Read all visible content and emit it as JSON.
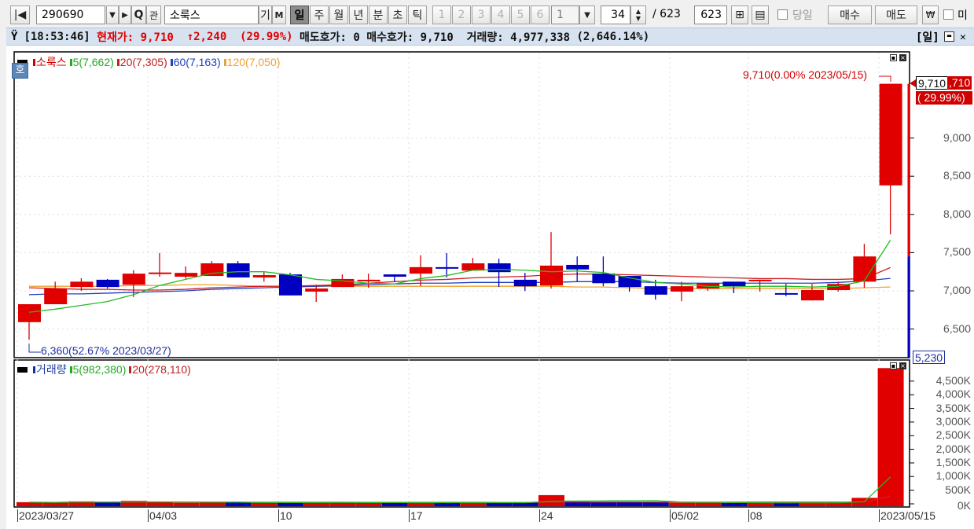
{
  "toolbar": {
    "code": "290690",
    "name": "소룩스",
    "search_icon": "Q",
    "gwan": "관",
    "gi": "기",
    "m": "M",
    "periods": [
      "일",
      "주",
      "월",
      "년",
      "분",
      "초",
      "틱"
    ],
    "selected_period": "일",
    "numbers": [
      "1",
      "2",
      "3",
      "4",
      "5",
      "6"
    ],
    "interval_select": "1",
    "view_count": "34",
    "total_sep": "/ 623",
    "total_input": "623",
    "same_day_label": "당일",
    "buy": "매수",
    "sell": "매도",
    "won": "₩",
    "mi_label": "미"
  },
  "info": {
    "time": "[18:53:46]",
    "current_label": "현재가: 9,710",
    "change": "↑2,240",
    "change_pct": "(29.99%)",
    "ask": "매도호가: 0",
    "bid": "매수호가: 9,710",
    "volume": "거래량: 4,977,338",
    "volume_pct": "(2,646.14%)",
    "period_badge": "[일]"
  },
  "price_legend": {
    "name": "소룩스",
    "ma5": "5(7,662)",
    "ma20": "20(7,305)",
    "ma60": "60(7,163)",
    "ma120": "120(7,050)",
    "badge": "호"
  },
  "volume_legend": {
    "name": "거래량",
    "ma5": "5(982,380)",
    "ma20": "20(278,110)"
  },
  "annotations": {
    "high": "9,710(0.00% 2023/05/15)",
    "low": "6,360(52.67% 2023/03/27)"
  },
  "price_marker": {
    "price": "9,710",
    "price_tail": ",710",
    "pct": "( 29.99%)",
    "bottom": "5,230"
  },
  "colors": {
    "up": "#e00000",
    "down": "#0000c0",
    "ma5": "#22bb22",
    "ma20": "#d02020",
    "ma60": "#2040c0",
    "ma120": "#f0a030"
  },
  "chart_data": {
    "type": "candlestick",
    "title": "소룩스",
    "price_axis_ticks": [
      "9,000",
      "8,500",
      "8,000",
      "7,500",
      "7,000",
      "6,500"
    ],
    "price_axis_values": [
      9000,
      8500,
      8000,
      7500,
      7000,
      6500
    ],
    "volume_axis_ticks": [
      "4,500K",
      "4,000K",
      "3,500K",
      "3,000K",
      "2,500K",
      "2,000K",
      "1,500K",
      "1,000K",
      "500K",
      "0K"
    ],
    "date_labels": [
      {
        "label": "2023/03/27",
        "index": 0
      },
      {
        "label": "04/03",
        "index": 5
      },
      {
        "label": "10",
        "index": 10
      },
      {
        "label": "17",
        "index": 15
      },
      {
        "label": "24",
        "index": 20
      },
      {
        "label": "05/02",
        "index": 25
      },
      {
        "label": "08",
        "index": 28
      },
      {
        "label": "2023/05/15",
        "index": 33
      }
    ],
    "ohlc": [
      [
        6590,
        6825,
        6360,
        6825
      ],
      [
        6825,
        7120,
        6825,
        7030
      ],
      [
        7050,
        7165,
        7000,
        7120
      ],
      [
        7145,
        7155,
        7030,
        7050
      ],
      [
        7080,
        7270,
        6920,
        7225
      ],
      [
        7220,
        7495,
        7185,
        7240
      ],
      [
        7185,
        7320,
        7160,
        7235
      ],
      [
        7195,
        7390,
        7195,
        7360
      ],
      [
        7360,
        7390,
        7175,
        7175
      ],
      [
        7175,
        7245,
        7120,
        7205
      ],
      [
        7215,
        7235,
        6940,
        6940
      ],
      [
        6990,
        7080,
        6855,
        7030
      ],
      [
        7050,
        7215,
        7050,
        7155
      ],
      [
        7130,
        7225,
        7040,
        7145
      ],
      [
        7215,
        7215,
        7120,
        7185
      ],
      [
        7225,
        7465,
        7060,
        7310
      ],
      [
        7310,
        7495,
        7175,
        7290
      ],
      [
        7265,
        7430,
        7265,
        7360
      ],
      [
        7360,
        7420,
        7050,
        7245
      ],
      [
        7145,
        7235,
        7000,
        7060
      ],
      [
        7070,
        7770,
        7030,
        7330
      ],
      [
        7340,
        7450,
        7120,
        7280
      ],
      [
        7225,
        7450,
        7060,
        7100
      ],
      [
        7195,
        7195,
        6990,
        7050
      ],
      [
        7060,
        7145,
        6885,
        6950
      ],
      [
        6990,
        7120,
        6865,
        7060
      ],
      [
        7030,
        7100,
        7000,
        7100
      ],
      [
        7120,
        7120,
        6970,
        7060
      ],
      [
        7140,
        7145,
        6990,
        7145
      ],
      [
        6970,
        7090,
        6930,
        6950
      ],
      [
        6875,
        7090,
        6875,
        7010
      ],
      [
        7010,
        7120,
        6990,
        7090
      ],
      [
        7120,
        7615,
        7040,
        7450
      ],
      [
        8380,
        9710,
        7740,
        9710
      ]
    ],
    "ma5": [
      6720,
      6760,
      6810,
      6860,
      6950,
      7070,
      7150,
      7230,
      7250,
      7250,
      7210,
      7150,
      7130,
      7100,
      7090,
      7160,
      7200,
      7270,
      7280,
      7270,
      7250,
      7260,
      7240,
      7170,
      7110,
      7090,
      7060,
      7050,
      7060,
      7060,
      7050,
      7060,
      7130,
      7662
    ],
    "ma20": [
      7040,
      7030,
      7020,
      7020,
      7010,
      7010,
      7020,
      7040,
      7050,
      7060,
      7060,
      7070,
      7080,
      7100,
      7120,
      7140,
      7150,
      7170,
      7180,
      7190,
      7210,
      7220,
      7220,
      7210,
      7200,
      7190,
      7180,
      7170,
      7160,
      7160,
      7150,
      7150,
      7160,
      7305
    ],
    "ma60": [
      6950,
      6960,
      6960,
      6970,
      6980,
      6990,
      7000,
      7020,
      7030,
      7040,
      7050,
      7060,
      7070,
      7080,
      7090,
      7100,
      7100,
      7110,
      7110,
      7110,
      7110,
      7120,
      7120,
      7120,
      7110,
      7100,
      7100,
      7100,
      7100,
      7100,
      7100,
      7110,
      7130,
      7163
    ],
    "ma120": [
      7060,
      7060,
      7060,
      7060,
      7070,
      7070,
      7080,
      7080,
      7070,
      7060,
      7060,
      7060,
      7060,
      7060,
      7060,
      7060,
      7060,
      7060,
      7060,
      7060,
      7060,
      7050,
      7050,
      7040,
      7030,
      7030,
      7030,
      7030,
      7030,
      7030,
      7030,
      7030,
      7040,
      7050
    ],
    "volume": [
      60000,
      50000,
      90000,
      45000,
      110000,
      60000,
      40000,
      45000,
      50000,
      40000,
      60000,
      40000,
      55000,
      40000,
      35000,
      50000,
      40000,
      45000,
      45000,
      40000,
      320000,
      80000,
      70000,
      70000,
      60000,
      40000,
      40000,
      35000,
      30000,
      40000,
      45000,
      50000,
      220000,
      4977338
    ],
    "volume_ma5_last": 982380,
    "volume_ma20_last": 278110
  }
}
